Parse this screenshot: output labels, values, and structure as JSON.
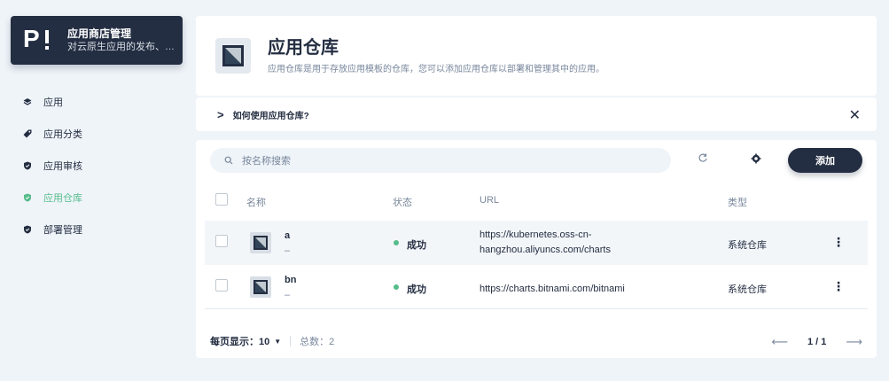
{
  "app": {
    "title": "应用商店管理",
    "description": "对云原生应用的发布、…"
  },
  "nav": [
    {
      "label": "应用",
      "icon": "layers-icon",
      "active": false
    },
    {
      "label": "应用分类",
      "icon": "tag-icon",
      "active": false
    },
    {
      "label": "应用审核",
      "icon": "shield-icon",
      "active": false
    },
    {
      "label": "应用仓库",
      "icon": "shield-icon",
      "active": true
    },
    {
      "label": "部署管理",
      "icon": "shield-icon",
      "active": false
    }
  ],
  "header": {
    "title": "应用仓库",
    "description": "应用仓库是用于存放应用模板的仓库，您可以添加应用仓库以部署和管理其中的应用。"
  },
  "howto": {
    "label": "如何使用应用仓库?"
  },
  "toolbar": {
    "search_placeholder": "按名称搜索",
    "add_label": "添加"
  },
  "table": {
    "columns": {
      "name": "名称",
      "status": "状态",
      "url": "URL",
      "type": "类型"
    },
    "rows": [
      {
        "name": "a",
        "sub": "–",
        "status": "成功",
        "url": "https://kubernetes.oss-cn-hangzhou.aliyuncs.com/charts",
        "type": "系统仓库"
      },
      {
        "name": "bn",
        "sub": "–",
        "status": "成功",
        "url": "https://charts.bitnami.com/bitnami",
        "type": "系统仓库"
      }
    ]
  },
  "footer": {
    "page_size_label": "每页显示：10",
    "total_label": "总数：2",
    "page_indicator": "1 / 1"
  },
  "colors": {
    "dark": "#242e42",
    "success": "#55bc8a",
    "background": "#eff4f9",
    "muted": "#79879c"
  }
}
